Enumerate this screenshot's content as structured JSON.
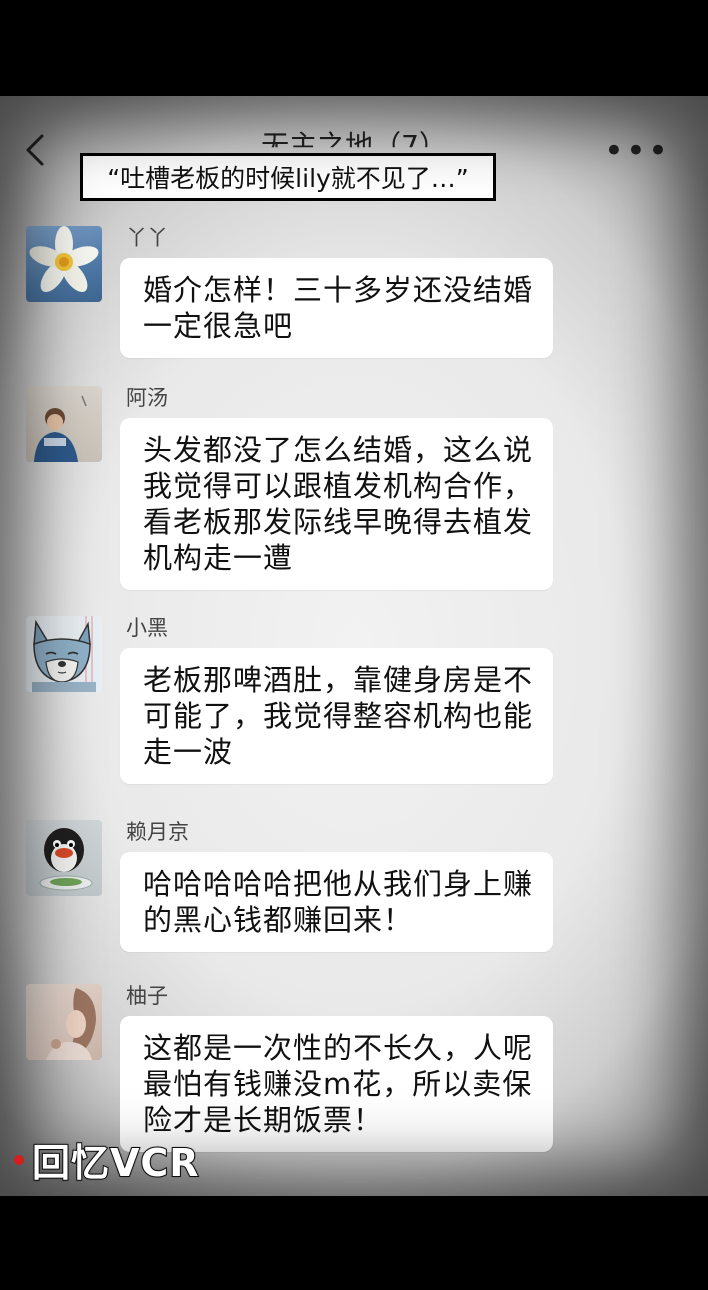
{
  "header": {
    "title": "无主之地（7）",
    "caption": "“吐槽老板的时候lily就不见了…”"
  },
  "messages": [
    {
      "sender": "丫丫",
      "avatar_icon": "daffodil-avatar-icon",
      "lines": [
        "婚介怎样！三十多岁还没结婚",
        "一定很急吧"
      ]
    },
    {
      "sender": "阿汤",
      "avatar_icon": "child-photo-avatar-icon",
      "lines": [
        "头发都没了怎么结婚，这么说",
        "我觉得可以跟植发机构合作，",
        "看老板那发际线早晚得去植发",
        "机构走一遭"
      ]
    },
    {
      "sender": "小黑",
      "avatar_icon": "cartoon-dog-avatar-icon",
      "lines": [
        "老板那啤酒肚，靠健身房是不",
        "可能了，我觉得整容机构也能",
        "走一波"
      ]
    },
    {
      "sender": "赖月京",
      "avatar_icon": "penguin-avatar-icon",
      "lines": [
        "哈哈哈哈哈把他从我们身上赚",
        "的黑心钱都赚回来！"
      ]
    },
    {
      "sender": "柚子",
      "avatar_icon": "girl-photo-avatar-icon",
      "lines": [
        "这都是一次性的不长久，人呢",
        "最怕有钱赚没m花，所以卖保",
        "险才是长期饭票！"
      ]
    }
  ],
  "watermark": {
    "text": "回忆VCR",
    "dot_color": "#d61e1e"
  }
}
